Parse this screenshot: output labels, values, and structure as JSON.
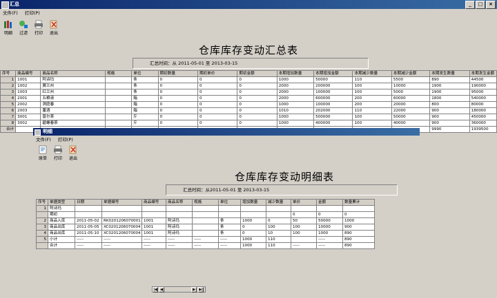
{
  "main": {
    "title": "汇总",
    "menu": [
      "文件(F)",
      "打印(P)"
    ],
    "toolbar": [
      {
        "label": "明细",
        "icon": "books-icon"
      },
      {
        "label": "过滤",
        "icon": "filter-icon"
      },
      {
        "label": "打印",
        "icon": "printer-icon"
      },
      {
        "label": "退出",
        "icon": "exit-icon"
      }
    ],
    "report_title": "仓库库存变动汇总表",
    "time_range": "汇总时间：从 2011-05-01 至 2013-03-15",
    "columns": [
      "序号",
      "商品编号",
      "商品名称",
      "规格",
      "单位",
      "期初数量",
      "期初单价",
      "期初金额",
      "本期增加数量",
      "本期增加金额",
      "本期减少数量",
      "本期减少金额",
      "本期发生数量",
      "本期发生金额"
    ],
    "rows": [
      [
        "1",
        "1001",
        "阿诗玛",
        "",
        "条",
        "0",
        "0",
        "0",
        "1000",
        "50000",
        "110",
        "5500",
        "890",
        "44500"
      ],
      [
        "2",
        "1002",
        "翼兰州",
        "",
        "条",
        "0",
        "0",
        "0",
        "2000",
        "200000",
        "100",
        "10000",
        "1900",
        "190000"
      ],
      [
        "3",
        "1003",
        "红兰州",
        "",
        "条",
        "0",
        "0",
        "0",
        "2000",
        "100000",
        "100",
        "5000",
        "1900",
        "95000"
      ],
      [
        "4",
        "2001",
        "五粮液",
        "",
        "箱",
        "0",
        "0",
        "0",
        "2000",
        "600000",
        "200",
        "60000",
        "1800",
        "540000"
      ],
      [
        "5",
        "2002",
        "洞庭春",
        "",
        "箱",
        "0",
        "0",
        "0",
        "1000",
        "100000",
        "200",
        "20000",
        "800",
        "80000"
      ],
      [
        "6",
        "2003",
        "董酒",
        "",
        "箱",
        "0",
        "0",
        "0",
        "1010",
        "202000",
        "110",
        "22000",
        "900",
        "180000"
      ],
      [
        "7",
        "3001",
        "普尔茶",
        "",
        "斤",
        "0",
        "0",
        "0",
        "1000",
        "500000",
        "100",
        "50000",
        "900",
        "450000"
      ],
      [
        "8",
        "3002",
        "碧螺春茶",
        "",
        "斤",
        "0",
        "0",
        "0",
        "1000",
        "400000",
        "100",
        "40000",
        "900",
        "360000"
      ]
    ],
    "total": [
      "合计",
      "",
      "",
      "",
      "",
      "",
      "",
      "",
      "",
      "",
      "",
      "",
      "9990",
      "1939500"
    ]
  },
  "detail": {
    "title": "明细",
    "menu": [
      "文件(F)",
      "打印(P)"
    ],
    "toolbar": [
      {
        "label": "原单",
        "icon": "document-icon"
      },
      {
        "label": "打印",
        "icon": "printer-icon"
      },
      {
        "label": "退出",
        "icon": "exit-icon"
      }
    ],
    "report_title": "仓库库存变动明细表",
    "time_range": "汇总时间：从2011-05-01 至 2013-03-15",
    "columns": [
      "序号",
      "单据类型",
      "日期",
      "单据编号",
      "商品编号",
      "商品名称",
      "规格",
      "单位",
      "增加数量",
      "减少数量",
      "单价",
      "金额",
      "数量累计"
    ],
    "rows": [
      [
        "1",
        "阿诗玛",
        "",
        "",
        "",
        "",
        "",
        "",
        "",
        "",
        "",
        "",
        ""
      ],
      [
        "",
        "期初",
        "",
        "",
        "",
        "",
        "",
        "",
        "",
        "",
        "0",
        "0",
        "0"
      ],
      [
        "2",
        "商品入库",
        "2011-05-02",
        "RK0201206070001",
        "1001",
        "阿诗玛",
        "",
        "条",
        "1000",
        "0",
        "50",
        "50000",
        "1000"
      ],
      [
        "3",
        "商品出库",
        "2011-05-05",
        "XC0201206070004",
        "1001",
        "阿诗玛",
        "",
        "条",
        "0",
        "100",
        "100",
        "10000",
        "900"
      ],
      [
        "4",
        "商品出库",
        "2011-05-10",
        "XC0201206070004",
        "1001",
        "阿诗玛",
        "",
        "条",
        "0",
        "10",
        "100",
        "1000",
        "890"
      ],
      [
        "5",
        "小计",
        "-----",
        "-----",
        "-----",
        "-----",
        "-----",
        "-----",
        "1000",
        "110",
        "",
        "-----",
        "890"
      ],
      [
        "",
        "合计",
        "-----",
        "-----",
        "-----",
        "-----",
        "-----",
        "-----",
        "1000",
        "110",
        "-----",
        "-----",
        "890"
      ]
    ]
  },
  "colors": {
    "titlebar": "#0a246a",
    "window": "#d4d0c8",
    "grid": "#ffffff"
  }
}
